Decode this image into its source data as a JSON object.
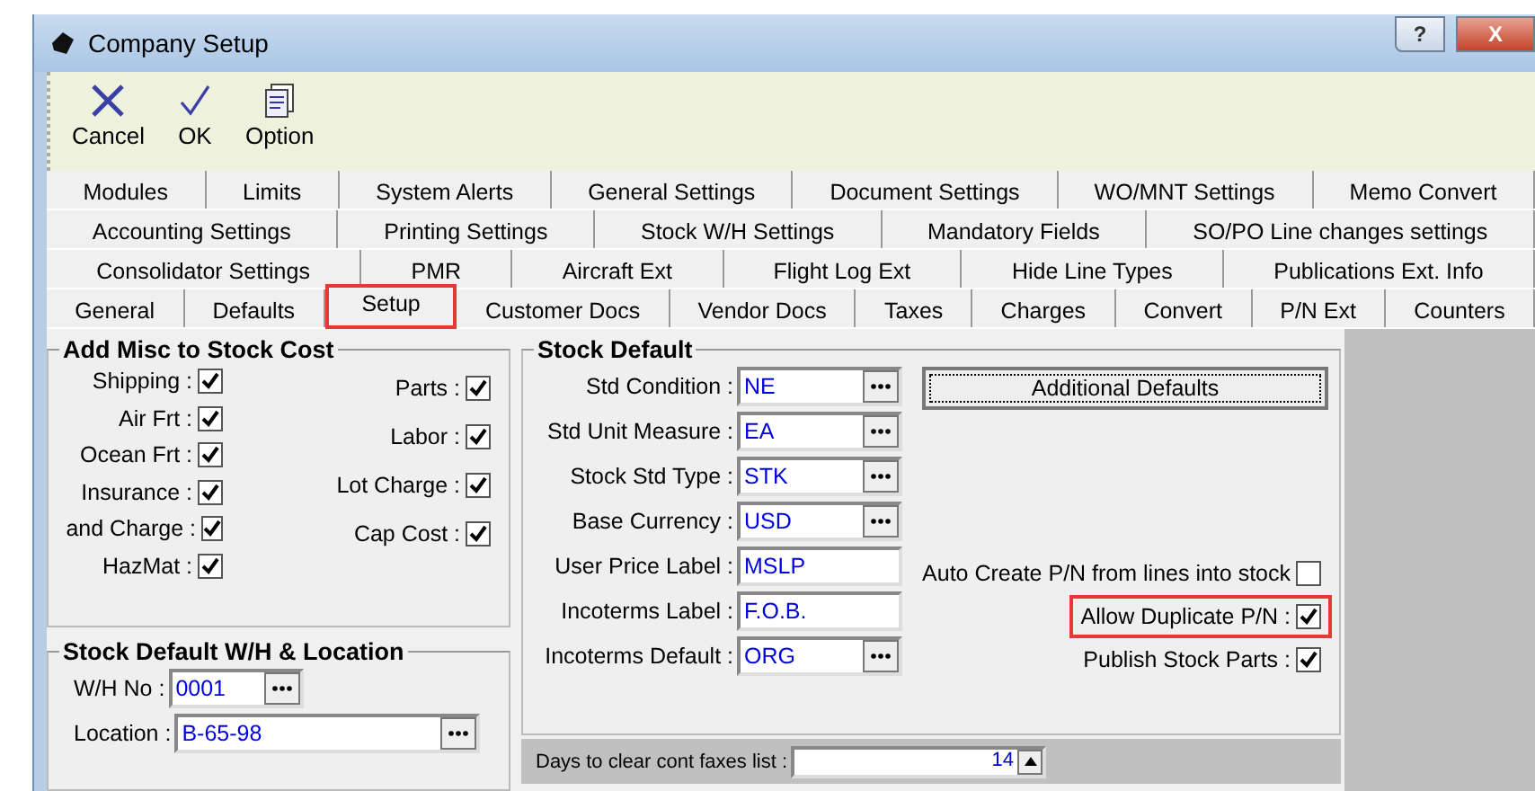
{
  "window": {
    "title": "Company Setup",
    "buttons": [
      {
        "kind": "help",
        "label": "?"
      },
      {
        "kind": "close",
        "label": "X"
      }
    ]
  },
  "toolbar": [
    {
      "label": "Cancel"
    },
    {
      "label": "OK"
    },
    {
      "label": "Option"
    }
  ],
  "tab_rows": [
    [
      {
        "label": "Modules",
        "selected": false
      },
      {
        "label": "Limits",
        "selected": false
      },
      {
        "label": "System Alerts",
        "selected": false
      },
      {
        "label": "General Settings",
        "selected": false
      },
      {
        "label": "Document Settings",
        "selected": false
      },
      {
        "label": "WO/MNT Settings",
        "selected": false
      },
      {
        "label": "Memo Convert",
        "selected": false
      }
    ],
    [
      {
        "label": "Accounting Settings",
        "selected": false
      },
      {
        "label": "Printing Settings",
        "selected": false
      },
      {
        "label": "Stock W/H Settings",
        "selected": false
      },
      {
        "label": "Mandatory Fields",
        "selected": false
      },
      {
        "label": "SO/PO Line changes settings",
        "selected": false
      }
    ],
    [
      {
        "label": "Consolidator Settings",
        "selected": false
      },
      {
        "label": "PMR",
        "selected": false
      },
      {
        "label": "Aircraft Ext",
        "selected": false
      },
      {
        "label": "Flight Log Ext",
        "selected": false
      },
      {
        "label": "Hide Line Types",
        "selected": false
      },
      {
        "label": "Publications Ext. Info",
        "selected": false
      }
    ],
    [
      {
        "label": "General",
        "selected": false
      },
      {
        "label": "Defaults",
        "selected": false
      },
      {
        "label": "Setup",
        "selected": true,
        "highlighted": true
      },
      {
        "label": "Customer Docs",
        "selected": false
      },
      {
        "label": "Vendor Docs",
        "selected": false
      },
      {
        "label": "Taxes",
        "selected": false
      },
      {
        "label": "Charges",
        "selected": false
      },
      {
        "label": "Convert",
        "selected": false
      },
      {
        "label": "P/N Ext",
        "selected": false
      },
      {
        "label": "Counters",
        "selected": false
      }
    ]
  ],
  "misc_cost": {
    "title": "Add Misc to Stock Cost",
    "left": [
      {
        "label": "Shipping :",
        "checked": true
      },
      {
        "label": "Air Frt :",
        "checked": true
      },
      {
        "label": "Ocean Frt :",
        "checked": true
      },
      {
        "label": "Insurance :",
        "checked": true
      },
      {
        "label": "and Charge :",
        "checked": true
      },
      {
        "label": "HazMat :",
        "checked": true
      }
    ],
    "right": [
      {
        "label": "Parts :",
        "checked": true
      },
      {
        "label": "Labor :",
        "checked": true
      },
      {
        "label": "Lot Charge :",
        "checked": true
      },
      {
        "label": "Cap Cost :",
        "checked": true
      }
    ]
  },
  "wh_location": {
    "title": "Stock Default W/H & Location",
    "fields": [
      {
        "label": "W/H No :",
        "value": "0001",
        "kind": "short"
      },
      {
        "label": "Location :",
        "value": "B-65-98",
        "kind": "long"
      }
    ]
  },
  "stock_default": {
    "title": "Stock Default",
    "button": "Additional Defaults",
    "fields": [
      {
        "label": "Std Condition :",
        "value": "NE",
        "kind": "browse"
      },
      {
        "label": "Std Unit Measure :",
        "value": "EA",
        "kind": "browse"
      },
      {
        "label": "Stock Std Type :",
        "value": "STK",
        "kind": "browse"
      },
      {
        "label": "Base Currency :",
        "value": "USD",
        "kind": "browse"
      },
      {
        "label": "User Price Label :",
        "value": "MSLP",
        "kind": "text"
      },
      {
        "label": "Incoterms Label  :",
        "value": "F.O.B.",
        "kind": "text"
      },
      {
        "label": "Incoterms Default :",
        "value": "ORG",
        "kind": "browse"
      }
    ],
    "options": [
      {
        "label": "Auto Create P/N from lines into stock",
        "checked": false,
        "highlighted": false
      },
      {
        "label": "Allow Duplicate P/N :",
        "checked": true,
        "highlighted": true
      },
      {
        "label": "Publish Stock Parts :",
        "checked": true,
        "highlighted": false
      }
    ]
  },
  "days": {
    "label": "Days to clear cont faxes list :",
    "value": "14"
  }
}
